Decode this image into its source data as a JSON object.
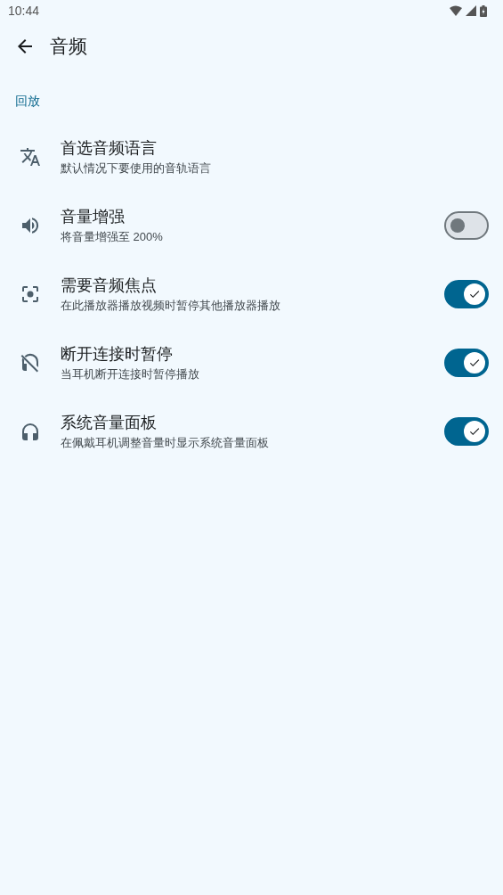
{
  "status_bar": {
    "time": "10:44"
  },
  "app_bar": {
    "title": "音频"
  },
  "section": {
    "title": "回放"
  },
  "settings": [
    {
      "kind": "link",
      "title": "首选音频语言",
      "summary": "默认情况下要使用的音轨语言"
    },
    {
      "kind": "switch",
      "title": "音量增强",
      "summary": "将音量增强至 200%",
      "on": false
    },
    {
      "kind": "switch",
      "title": "需要音频焦点",
      "summary": "在此播放器播放视频时暂停其他播放器播放",
      "on": true
    },
    {
      "kind": "switch",
      "title": "断开连接时暂停",
      "summary": "当耳机断开连接时暂停播放",
      "on": true
    },
    {
      "kind": "switch",
      "title": "系统音量面板",
      "summary": "在佩戴耳机调整音量时显示系统音量面板",
      "on": true
    }
  ]
}
